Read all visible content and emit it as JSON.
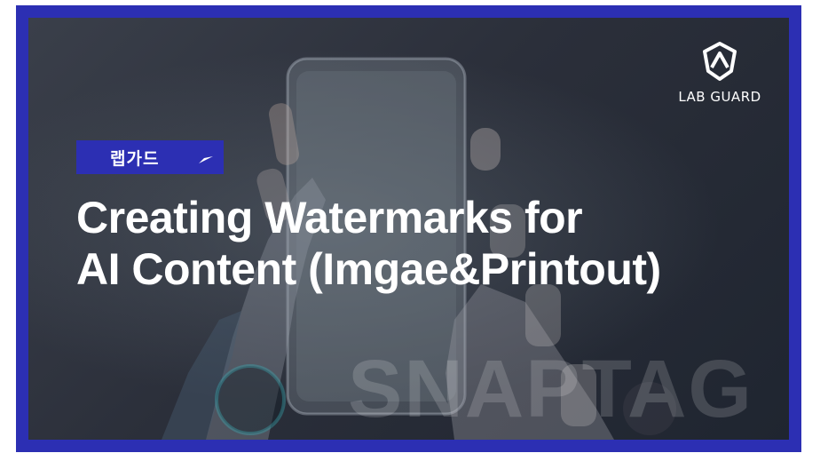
{
  "logo": {
    "icon": "shield-icon",
    "text": "LAB GUARD"
  },
  "tag": {
    "label": "랩가드",
    "icon": "play-arrow-icon"
  },
  "title": {
    "line1": "Creating Watermarks for",
    "line2": "AI Content (Imgae&Printout)"
  },
  "watermark": {
    "text": "SNAPTAG"
  },
  "colors": {
    "border": "#2c2fb3",
    "tag_background": "#2c2fb3",
    "text": "#ffffff",
    "background": "#2b2f3a"
  }
}
